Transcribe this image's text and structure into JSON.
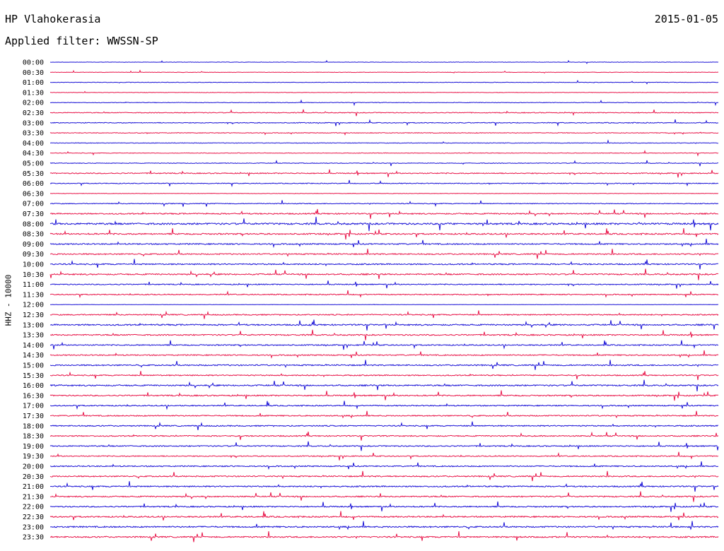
{
  "header": {
    "station": "HP Vlahokerasia",
    "date": "2015-01-05",
    "filter": "Applied filter: WWSSN-SP"
  },
  "chart_data": {
    "type": "line",
    "title": "HP Vlahokerasia",
    "ylabel": "HHZ - 10000",
    "colors": [
      "#1a12d6",
      "#e8164a"
    ],
    "rows": [
      {
        "label": "00:00",
        "level": 0.15
      },
      {
        "label": "00:30",
        "level": 0.2
      },
      {
        "label": "01:00",
        "level": 0.2
      },
      {
        "label": "01:30",
        "level": 0.2
      },
      {
        "label": "02:00",
        "level": 0.25
      },
      {
        "label": "02:30",
        "level": 0.35
      },
      {
        "label": "03:00",
        "level": 0.35
      },
      {
        "label": "03:30",
        "level": 0.3
      },
      {
        "label": "04:00",
        "level": 0.25
      },
      {
        "label": "04:30",
        "level": 0.25
      },
      {
        "label": "05:00",
        "level": 0.3
      },
      {
        "label": "05:30",
        "level": 0.45
      },
      {
        "label": "06:00",
        "level": 0.35
      },
      {
        "label": "06:30",
        "level": 0.2
      },
      {
        "label": "07:00",
        "level": 0.35
      },
      {
        "label": "07:30",
        "level": 0.55
      },
      {
        "label": "08:00",
        "level": 0.75
      },
      {
        "label": "08:30",
        "level": 0.6
      },
      {
        "label": "09:00",
        "level": 0.55
      },
      {
        "label": "09:30",
        "level": 0.55
      },
      {
        "label": "10:00",
        "level": 0.55
      },
      {
        "label": "10:30",
        "level": 0.6
      },
      {
        "label": "11:00",
        "level": 0.45
      },
      {
        "label": "11:30",
        "level": 0.45
      },
      {
        "label": "12:00",
        "level": 0.15
      },
      {
        "label": "12:30",
        "level": 0.5
      },
      {
        "label": "13:00",
        "level": 0.6
      },
      {
        "label": "13:30",
        "level": 0.55
      },
      {
        "label": "14:00",
        "level": 0.5
      },
      {
        "label": "14:30",
        "level": 0.5
      },
      {
        "label": "15:00",
        "level": 0.55
      },
      {
        "label": "15:30",
        "level": 0.5
      },
      {
        "label": "16:00",
        "level": 0.6
      },
      {
        "label": "16:30",
        "level": 0.55
      },
      {
        "label": "17:00",
        "level": 0.5
      },
      {
        "label": "17:30",
        "level": 0.5
      },
      {
        "label": "18:00",
        "level": 0.5
      },
      {
        "label": "18:30",
        "level": 0.5
      },
      {
        "label": "19:00",
        "level": 0.5
      },
      {
        "label": "19:30",
        "level": 0.45
      },
      {
        "label": "20:00",
        "level": 0.5
      },
      {
        "label": "20:30",
        "level": 0.55
      },
      {
        "label": "21:00",
        "level": 0.55
      },
      {
        "label": "21:30",
        "level": 0.55
      },
      {
        "label": "22:00",
        "level": 0.55
      },
      {
        "label": "22:30",
        "level": 0.6
      },
      {
        "label": "23:00",
        "level": 0.6
      },
      {
        "label": "23:30",
        "level": 0.6
      }
    ],
    "grid": false,
    "legend": "none"
  }
}
